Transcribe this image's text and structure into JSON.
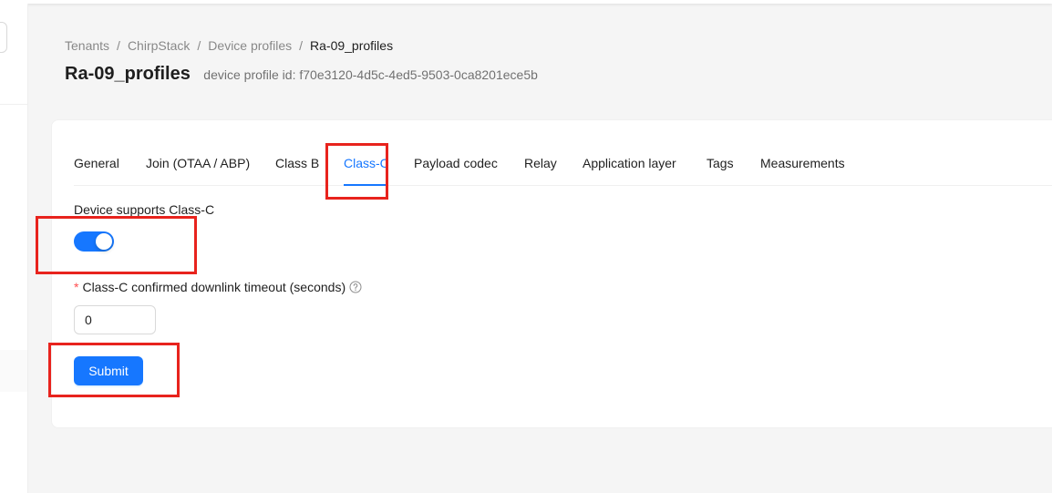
{
  "breadcrumb": {
    "items": [
      "Tenants",
      "ChirpStack",
      "Device profiles",
      "Ra-09_profiles"
    ],
    "separator": "/"
  },
  "header": {
    "title": "Ra-09_profiles",
    "subtitle": "device profile id: f70e3120-4d5c-4ed5-9503-0ca8201ece5b"
  },
  "tabs": [
    {
      "label": "General",
      "active": false
    },
    {
      "label": "Join (OTAA / ABP)",
      "active": false
    },
    {
      "label": "Class B",
      "active": false
    },
    {
      "label": "Class-C",
      "active": true
    },
    {
      "label": "Payload codec",
      "active": false
    },
    {
      "label": "Relay",
      "active": false
    },
    {
      "label": "Application layer",
      "active": false
    },
    {
      "label": "Tags",
      "active": false
    },
    {
      "label": "Measurements",
      "active": false
    }
  ],
  "form": {
    "supports_class_c_label": "Device supports Class-C",
    "supports_class_c_value": true,
    "required_mark": "*",
    "timeout_label": "Class-C confirmed downlink timeout (seconds)",
    "timeout_value": "0",
    "submit_label": "Submit"
  },
  "colors": {
    "primary": "#1677ff",
    "highlight": "#e8231d",
    "required": "#ff4d4f"
  },
  "icons": {
    "help": "question-circle-icon"
  }
}
